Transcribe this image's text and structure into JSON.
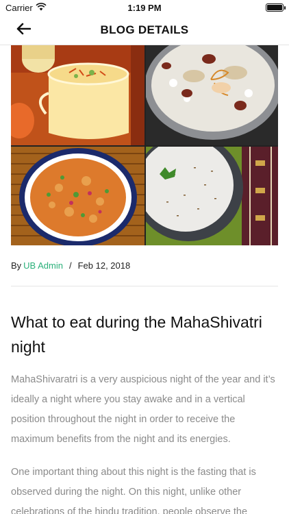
{
  "status_bar": {
    "carrier": "Carrier",
    "time": "1:19 PM",
    "icons": [
      "wifi-icon",
      "battery-icon"
    ]
  },
  "nav": {
    "back_icon": "arrow-left-icon",
    "title": "BLOG DETAILS"
  },
  "hero": {
    "images": [
      "saffron-milk-drink",
      "kheer-with-dates",
      "sabudana-khichdi",
      "buttermilk-with-cumin"
    ]
  },
  "post": {
    "by_label": "By",
    "author": "UB Admin",
    "separator": "/",
    "date": "Feb 12, 2018",
    "title": "What to eat during the MahaShivatri night",
    "paragraphs": [
      "MahaShivaratri is a very auspicious night of the year and it’s ideally a night where you stay awake and in a vertical position throughout the night in order to receive the maximum benefits from the night and its energies.",
      "One important thing about this night is the fasting that is observed during the night. On this night, unlike other celebrations of the hindu tradition, people observe the"
    ]
  },
  "colors": {
    "accent": "#2bb07a",
    "body_text": "#8a8a8a",
    "divider": "#e6e6e6"
  }
}
